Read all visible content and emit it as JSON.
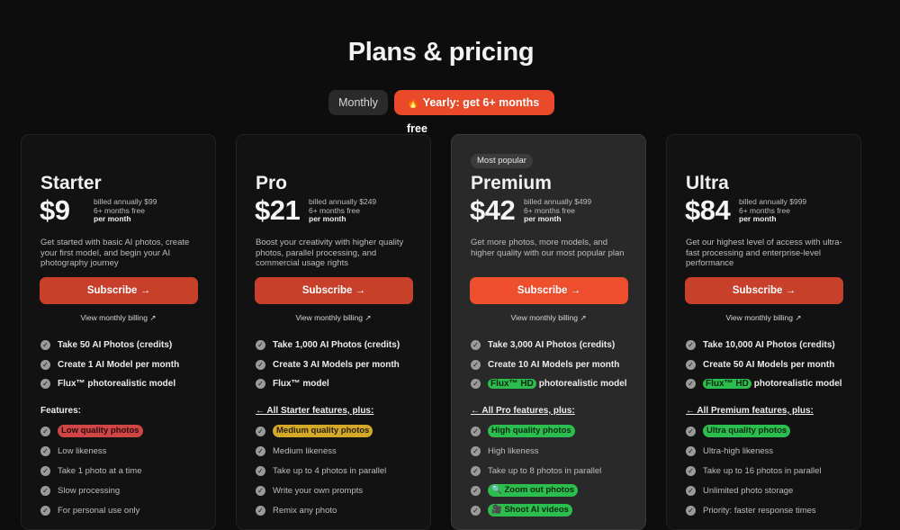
{
  "page": {
    "title": "Plans & pricing"
  },
  "toggle": {
    "monthly": "Monthly",
    "yearly_icon": "🔥",
    "yearly": "Yearly: get 6+ months free"
  },
  "colors": {
    "accent": "#e84a2a",
    "green_tag": "#2bbd4d",
    "red_tag": "#d04545",
    "yellow_tag": "#d4a928"
  },
  "plans": [
    {
      "name": "Starter",
      "price": "$9",
      "billing": [
        "billed annually $99",
        "6+ months free",
        "per month"
      ],
      "desc": "Get started with basic AI photos, create your first model, and begin your AI photography journey",
      "subscribe": "Subscribe →",
      "monthly_link": "View monthly billing ↗",
      "items": [
        {
          "tag": "",
          "text": "Take 50 AI Photos (credits)"
        },
        {
          "tag": "",
          "text": "Create 1 AI Model per month"
        },
        {
          "tag": "",
          "text": "Flux™ photorealistic model"
        }
      ],
      "features_heading": "Features:",
      "features": [
        {
          "text": "Low quality photos",
          "pill": "red"
        },
        {
          "text": "Low likeness",
          "pill": ""
        },
        {
          "text": "Take 1 photo at a time",
          "pill": ""
        },
        {
          "text": "Slow processing",
          "pill": ""
        },
        {
          "text": "For personal use only",
          "pill": ""
        }
      ]
    },
    {
      "name": "Pro",
      "price": "$21",
      "billing": [
        "billed annually $249",
        "6+ months free",
        "per month"
      ],
      "desc": "Boost your creativity with higher quality photos, parallel processing, and commercial usage rights",
      "subscribe": "Subscribe →",
      "monthly_link": "View monthly billing ↗",
      "items": [
        {
          "tag": "",
          "text": "Take 1,000 AI Photos (credits)"
        },
        {
          "tag": "",
          "text": "Create 3 AI Models per month"
        },
        {
          "tag": "",
          "text": "Flux™ model"
        }
      ],
      "features_heading": "← All Starter features, plus:",
      "features": [
        {
          "text": "Medium quality photos",
          "pill": "yellow"
        },
        {
          "text": "Medium likeness",
          "pill": ""
        },
        {
          "text": "Take up to 4 photos in parallel",
          "pill": ""
        },
        {
          "text": "Write your own prompts",
          "pill": ""
        },
        {
          "text": "Remix any photo",
          "pill": ""
        }
      ]
    },
    {
      "name": "Premium",
      "price": "$42",
      "badge": "Most popular",
      "billing": [
        "billed annually $499",
        "6+ months free",
        "per month"
      ],
      "desc": "Get more photos, more models, and higher quality with our most popular plan",
      "subscribe": "Subscribe →",
      "monthly_link": "View monthly billing ↗",
      "items": [
        {
          "tag": "",
          "text": "Take 3,000 AI Photos (credits)"
        },
        {
          "tag": "",
          "text": "Create 10 AI Models per month"
        },
        {
          "tag": "Flux™ HD",
          "text": "photorealistic model"
        }
      ],
      "features_heading": "← All Pro features, plus:",
      "features": [
        {
          "text": "High quality photos",
          "pill": "green"
        },
        {
          "text": "High likeness",
          "pill": ""
        },
        {
          "text": "Take up to 8 photos in parallel",
          "pill": ""
        },
        {
          "text": "🔍 Zoom out photos",
          "pill": "green"
        },
        {
          "text": "🎥 Shoot AI videos",
          "pill": "green"
        }
      ]
    },
    {
      "name": "Ultra",
      "price": "$84",
      "billing": [
        "billed annually $999",
        "6+ months free",
        "per month"
      ],
      "desc": "Get our highest level of access with ultra-fast processing and enterprise-level performance",
      "subscribe": "Subscribe →",
      "monthly_link": "View monthly billing ↗",
      "items": [
        {
          "tag": "",
          "text": "Take 10,000 AI Photos (credits)"
        },
        {
          "tag": "",
          "text": "Create 50 AI Models per month"
        },
        {
          "tag": "Flux™ HD",
          "text": "photorealistic model"
        }
      ],
      "features_heading": "← All Premium features, plus:",
      "features": [
        {
          "text": "Ultra quality photos",
          "pill": "green"
        },
        {
          "text": "Ultra-high likeness",
          "pill": ""
        },
        {
          "text": "Take up to 16 photos in parallel",
          "pill": ""
        },
        {
          "text": "Unlimited photo storage",
          "pill": ""
        },
        {
          "text": "Priority: faster response times",
          "pill": ""
        }
      ]
    }
  ]
}
